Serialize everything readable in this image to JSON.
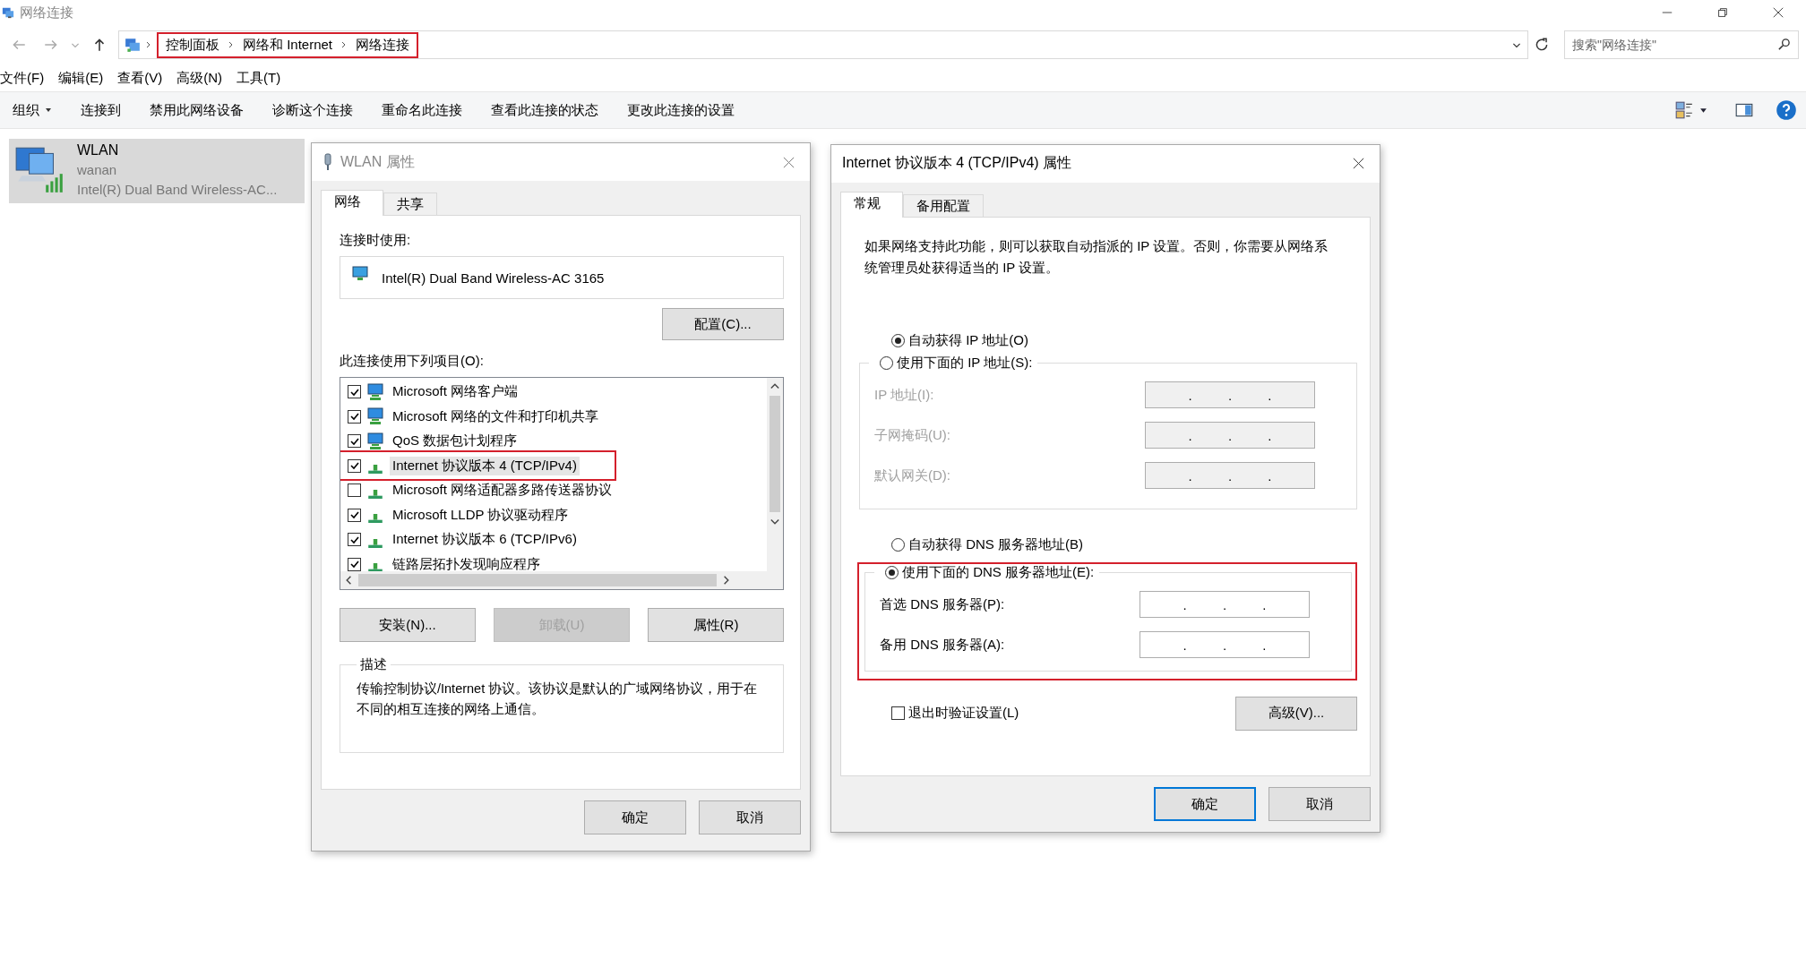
{
  "window": {
    "title": "网络连接"
  },
  "address_bar": {
    "breadcrumbs": [
      "控制面板",
      "网络和 Internet",
      "网络连接"
    ],
    "highlighted": true
  },
  "search": {
    "placeholder": "搜索\"网络连接\""
  },
  "menu": [
    "文件(F)",
    "编辑(E)",
    "查看(V)",
    "高级(N)",
    "工具(T)"
  ],
  "toolbar": [
    {
      "label": "组织",
      "dropdown": true
    },
    {
      "label": "连接到",
      "dropdown": false
    },
    {
      "label": "禁用此网络设备",
      "dropdown": false
    },
    {
      "label": "诊断这个连接",
      "dropdown": false
    },
    {
      "label": "重命名此连接",
      "dropdown": false
    },
    {
      "label": "查看此连接的状态",
      "dropdown": false
    },
    {
      "label": "更改此连接的设置",
      "dropdown": false
    }
  ],
  "connections": [
    {
      "name": "WLAN",
      "network": "wanan",
      "adapter": "Intel(R) Dual Band Wireless-AC...",
      "selected": true
    }
  ],
  "wlan_dialog": {
    "title": "WLAN 属性",
    "tabs": [
      {
        "label": "网络",
        "selected": true
      },
      {
        "label": "共享",
        "selected": false
      }
    ],
    "connect_using_label": "连接时使用:",
    "adapter": "Intel(R) Dual Band Wireless-AC 3165",
    "configure_button": "配置(C)...",
    "items_label": "此连接使用下列项目(O):",
    "items": [
      {
        "kind": "client",
        "label": "Microsoft 网络客户端",
        "checked": true,
        "selected": false,
        "highlighted": false
      },
      {
        "kind": "client",
        "label": "Microsoft 网络的文件和打印机共享",
        "checked": true,
        "selected": false,
        "highlighted": false
      },
      {
        "kind": "client",
        "label": "QoS 数据包计划程序",
        "checked": true,
        "selected": false,
        "highlighted": false
      },
      {
        "kind": "protocol",
        "label": "Internet 协议版本 4 (TCP/IPv4)",
        "checked": true,
        "selected": true,
        "highlighted": true
      },
      {
        "kind": "protocol",
        "label": "Microsoft 网络适配器多路传送器协议",
        "checked": false,
        "selected": false,
        "highlighted": false
      },
      {
        "kind": "protocol",
        "label": "Microsoft LLDP 协议驱动程序",
        "checked": true,
        "selected": false,
        "highlighted": false
      },
      {
        "kind": "protocol",
        "label": "Internet 协议版本 6 (TCP/IPv6)",
        "checked": true,
        "selected": false,
        "highlighted": false
      },
      {
        "kind": "protocol",
        "label": "链路层拓扑发现响应程序",
        "checked": true,
        "selected": false,
        "highlighted": false
      }
    ],
    "buttons": [
      {
        "label": "安装(N)...",
        "disabled": false
      },
      {
        "label": "卸载(U)",
        "disabled": true
      },
      {
        "label": "属性(R)",
        "disabled": false
      }
    ],
    "description": {
      "legend": "描述",
      "text": "传输控制协议/Internet 协议。该协议是默认的广域网络协议，用于在不同的相互连接的网络上通信。"
    },
    "footer": [
      {
        "label": "确定",
        "default": false
      },
      {
        "label": "取消",
        "default": false
      }
    ]
  },
  "ipv4_dialog": {
    "title": "Internet 协议版本 4 (TCP/IPv4) 属性",
    "tabs": [
      {
        "label": "常规",
        "selected": true
      },
      {
        "label": "备用配置",
        "selected": false
      }
    ],
    "intro": "如果网络支持此功能，则可以获取自动指派的 IP 设置。否则，你需要从网络系统管理员处获得适当的 IP 设置。",
    "ip_mode": [
      {
        "label": "自动获得 IP 地址(O)",
        "selected": true
      },
      {
        "label": "使用下面的 IP 地址(S):",
        "selected": false
      }
    ],
    "ip_group": {
      "disabled": true,
      "fields": [
        {
          "label": "IP 地址(I):",
          "value": ". . ."
        },
        {
          "label": "子网掩码(U):",
          "value": ". . ."
        },
        {
          "label": "默认网关(D):",
          "value": ". . ."
        }
      ]
    },
    "dns_mode": [
      {
        "label": "自动获得 DNS 服务器地址(B)",
        "selected": false
      },
      {
        "label": "使用下面的 DNS 服务器地址(E):",
        "selected": true
      }
    ],
    "dns_group": {
      "disabled": false,
      "highlighted": true,
      "fields": [
        {
          "label": "首选 DNS 服务器(P):",
          "value": ". . ."
        },
        {
          "label": "备用 DNS 服务器(A):",
          "value": ". . ."
        }
      ]
    },
    "validate": {
      "label": "退出时验证设置(L)",
      "checked": false
    },
    "advanced_button": "高级(V)...",
    "footer": [
      {
        "label": "确定",
        "default": true
      },
      {
        "label": "取消",
        "default": false
      }
    ]
  }
}
